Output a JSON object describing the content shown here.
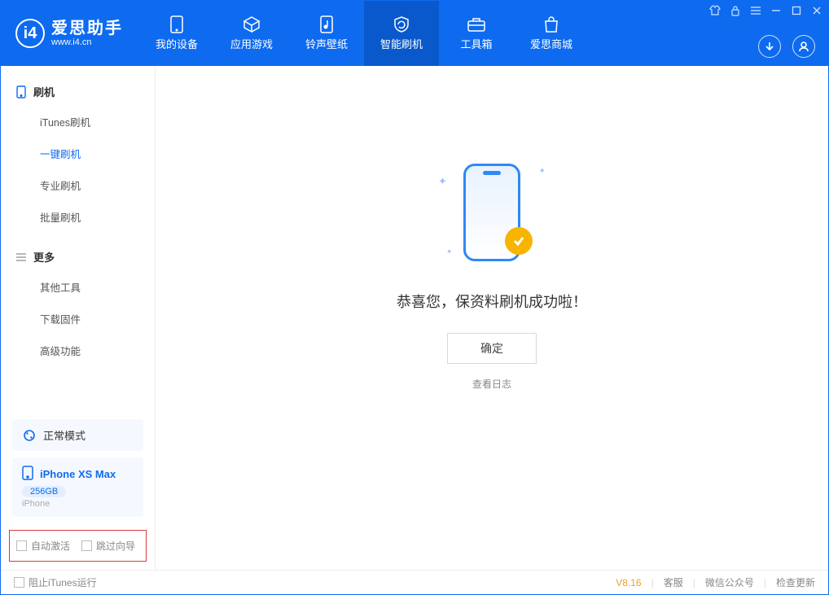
{
  "app": {
    "title": "爱思助手",
    "subtitle": "www.i4.cn"
  },
  "nav": {
    "items": [
      {
        "id": "device",
        "label": "我的设备"
      },
      {
        "id": "apps",
        "label": "应用游戏"
      },
      {
        "id": "ringtones",
        "label": "铃声壁纸"
      },
      {
        "id": "flash",
        "label": "智能刷机"
      },
      {
        "id": "toolbox",
        "label": "工具箱"
      },
      {
        "id": "store",
        "label": "爱思商城"
      }
    ],
    "active": "flash"
  },
  "sidebar": {
    "groups": [
      {
        "id": "flash",
        "label": "刷机",
        "icon": "device-icon",
        "items": [
          {
            "id": "itunes",
            "label": "iTunes刷机"
          },
          {
            "id": "oneclick",
            "label": "一键刷机",
            "active": true
          },
          {
            "id": "pro",
            "label": "专业刷机"
          },
          {
            "id": "batch",
            "label": "批量刷机"
          }
        ]
      },
      {
        "id": "more",
        "label": "更多",
        "icon": "menu-icon",
        "items": [
          {
            "id": "other",
            "label": "其他工具"
          },
          {
            "id": "firmware",
            "label": "下载固件"
          },
          {
            "id": "advanced",
            "label": "高级功能"
          }
        ]
      }
    ],
    "mode_box": {
      "label": "正常模式",
      "icon": "status-icon"
    },
    "device_box": {
      "name": "iPhone XS Max",
      "capacity": "256GB",
      "type": "iPhone"
    },
    "bottom_options": {
      "auto_activate": "自动激活",
      "skip_guide": "跳过向导"
    }
  },
  "main": {
    "success_text": "恭喜您，保资料刷机成功啦！",
    "ok_button": "确定",
    "log_link": "查看日志"
  },
  "footer": {
    "block_itunes": "阻止iTunes运行",
    "version": "V8.16",
    "links": {
      "support": "客服",
      "wechat": "微信公众号",
      "update": "检查更新"
    }
  }
}
